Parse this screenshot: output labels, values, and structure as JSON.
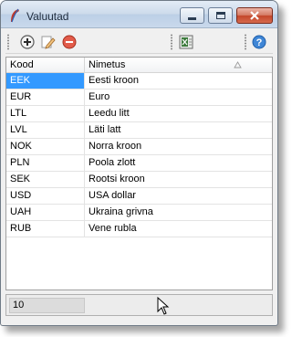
{
  "window": {
    "title": "Valuutad"
  },
  "toolbar": {
    "buttons": [
      {
        "name": "add",
        "icon": "plus-circle-icon"
      },
      {
        "name": "edit",
        "icon": "pencil-edit-icon"
      },
      {
        "name": "delete",
        "icon": "minus-circle-icon"
      },
      {
        "name": "export",
        "icon": "excel-export-icon"
      },
      {
        "name": "help",
        "icon": "help-icon"
      }
    ]
  },
  "grid": {
    "columns": [
      "Kood",
      "Nimetus"
    ],
    "sorted_column": "Nimetus",
    "rows": [
      {
        "code": "EEK",
        "name": "Eesti kroon"
      },
      {
        "code": "EUR",
        "name": "Euro"
      },
      {
        "code": "LTL",
        "name": "Leedu litt"
      },
      {
        "code": "LVL",
        "name": "Läti latt"
      },
      {
        "code": "NOK",
        "name": "Norra kroon"
      },
      {
        "code": "PLN",
        "name": "Poola zlott"
      },
      {
        "code": "SEK",
        "name": "Rootsi kroon"
      },
      {
        "code": "USD",
        "name": "USA dollar"
      },
      {
        "code": "UAH",
        "name": "Ukraina grivna"
      },
      {
        "code": "RUB",
        "name": "Vene rubla"
      }
    ],
    "selected_row": "EEK"
  },
  "status": {
    "count": "10"
  },
  "colors": {
    "selection": "#3399ff",
    "title_bar": "#cddbeb",
    "close_button": "#c4462a"
  }
}
